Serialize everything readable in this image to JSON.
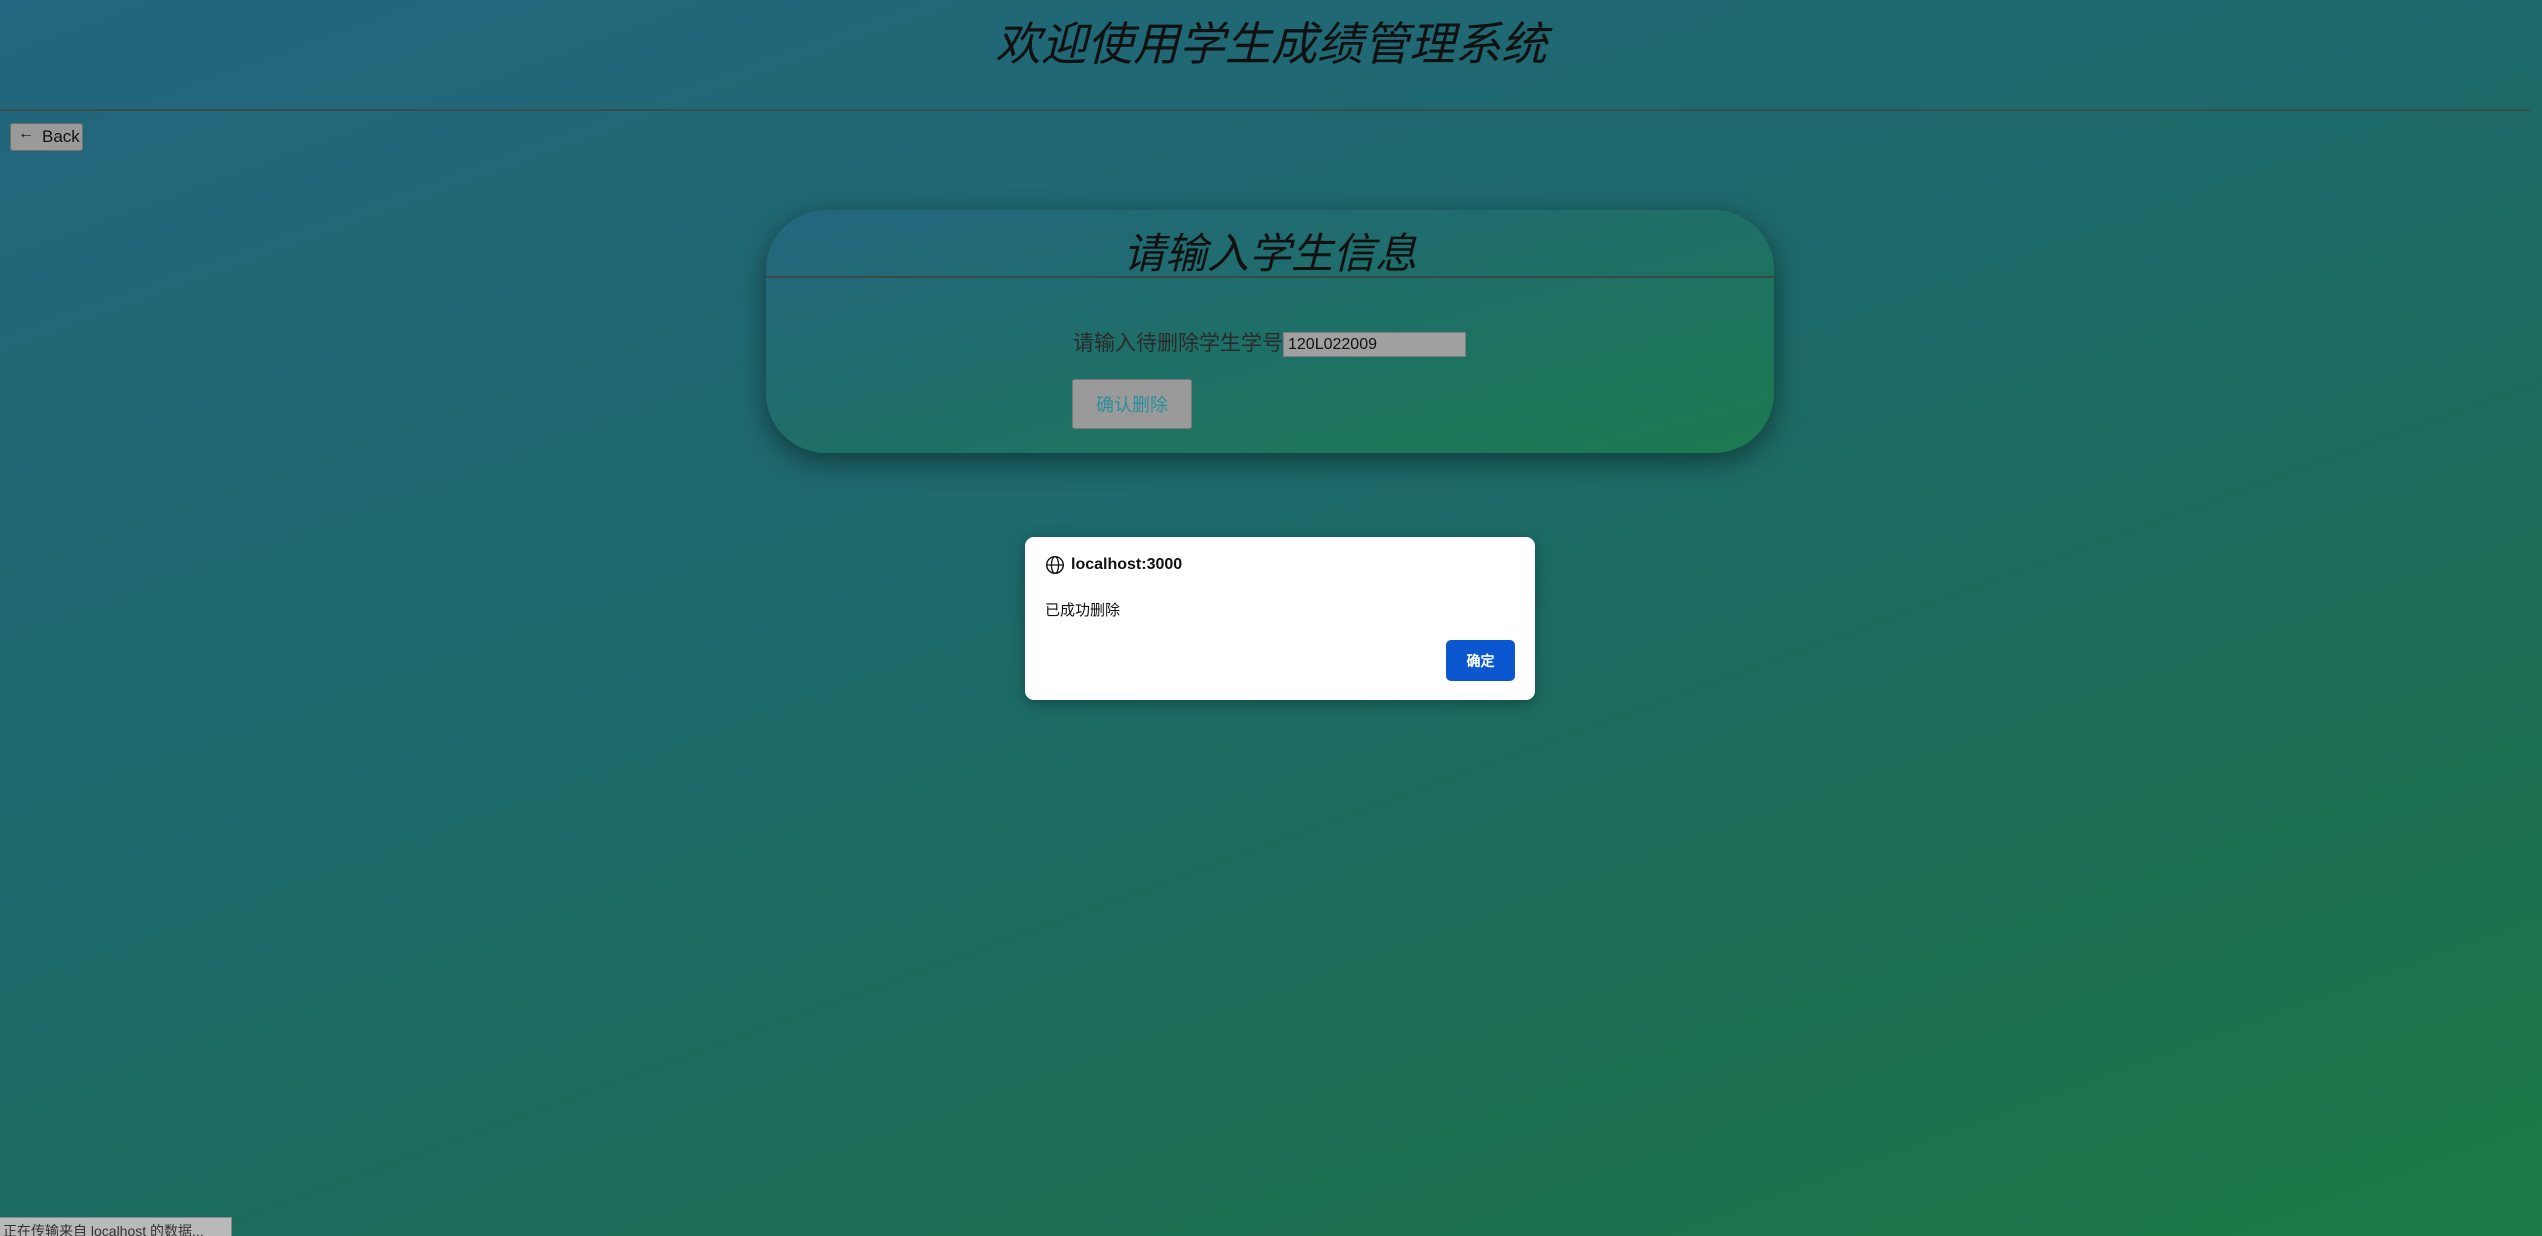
{
  "header": {
    "title": "欢迎使用学生成绩管理系统",
    "back_label": "Back"
  },
  "form": {
    "title": "请输入学生信息",
    "student_id_label": "请输入待删除学生学号:",
    "student_id_value": "120L022009",
    "confirm_delete_label": "确认删除"
  },
  "dialog": {
    "origin": "localhost:3000",
    "message": "已成功删除",
    "ok_label": "确定"
  },
  "status_bar": {
    "text": "正在传输来自 localhost 的数据..."
  },
  "icons": {
    "back": "arrow-left-icon",
    "dialog": "globe-icon"
  },
  "colors": {
    "dialog_button": "#0b57d0"
  }
}
